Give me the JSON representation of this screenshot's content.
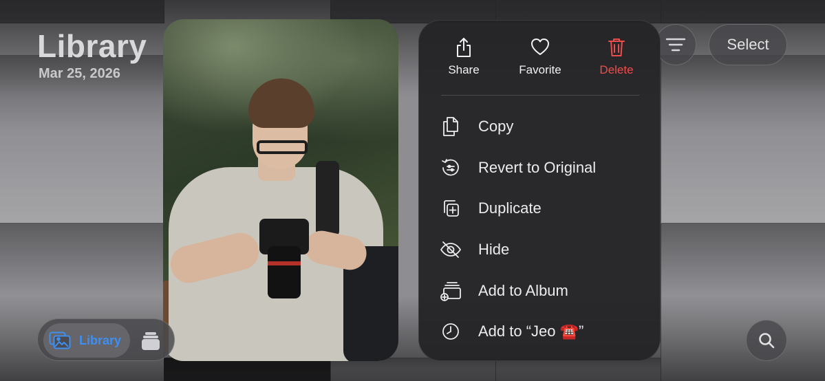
{
  "header": {
    "title": "Library",
    "date": "Mar 25, 2026",
    "select_label": "Select"
  },
  "tabbar": {
    "active_label": "Library",
    "active_color": "#3f8ff0"
  },
  "context_menu": {
    "actions": [
      {
        "label": "Share",
        "icon": "share-icon"
      },
      {
        "label": "Favorite",
        "icon": "heart-icon"
      },
      {
        "label": "Delete",
        "icon": "trash-icon",
        "color": "#ef4d4d"
      }
    ],
    "items": [
      {
        "label": "Copy",
        "icon": "copy-icon"
      },
      {
        "label": "Revert to Original",
        "icon": "revert-icon"
      },
      {
        "label": "Duplicate",
        "icon": "duplicate-icon"
      },
      {
        "label": "Hide",
        "icon": "eye-slash-icon"
      },
      {
        "label": "Add to Album",
        "icon": "add-album-icon"
      },
      {
        "label": "Add to “Jeo ☎️”",
        "icon": "clock-icon"
      }
    ]
  }
}
